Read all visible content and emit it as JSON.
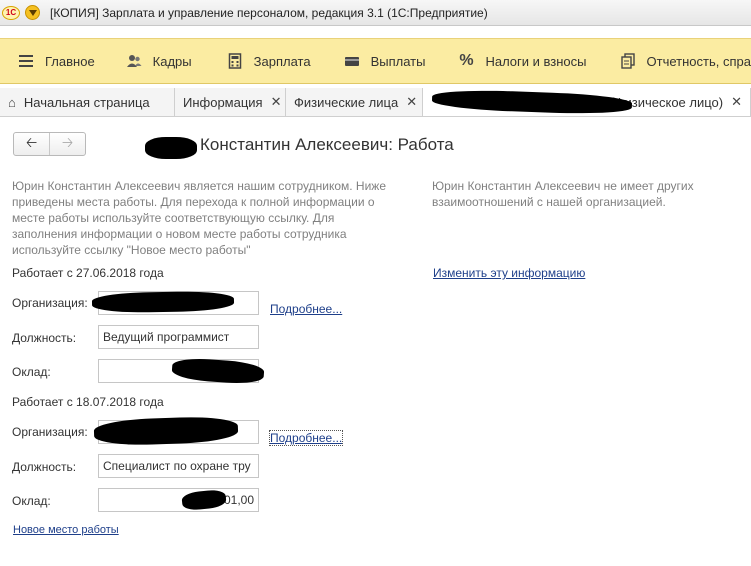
{
  "window": {
    "title": "[КОПИЯ] Зарплата и управление персоналом, редакция 3.1  (1С:Предприятие)"
  },
  "sections": [
    {
      "label": "Главное",
      "icon": "menu-lines-icon"
    },
    {
      "label": "Кадры",
      "icon": "people-icon"
    },
    {
      "label": "Зарплата",
      "icon": "calculator-icon"
    },
    {
      "label": "Выплаты",
      "icon": "wallet-icon"
    },
    {
      "label": "Налоги и взносы",
      "icon": "percent-icon"
    },
    {
      "label": "Отчетность, справ",
      "icon": "documents-icon"
    }
  ],
  "tabs": [
    {
      "label": "Начальная страница"
    },
    {
      "label": "Информация"
    },
    {
      "label": "Физические лица"
    },
    {
      "label": "(Физическое лицо)"
    }
  ],
  "form": {
    "title": "Константин Алексеевич: Работа",
    "intro": "Юрин Константин Алексеевич является нашим сотрудником. Ниже приведены места работы. Для перехода к полной информации о месте работы используйте соответствующую ссылку. Для заполнения информации о новом месте работы сотрудника используйте ссылку \"Новое место работы\"",
    "side_note": "Юрин Константин Алексеевич не имеет других взаимоотношений с нашей организацией.",
    "change_link": "Изменить эту информацию",
    "jobs": [
      {
        "since": "Работает с 27.06.2018 года",
        "org_label": "Организация:",
        "org_value": "",
        "more_link": "Подробнее...",
        "position_label": "Должность:",
        "position_value": "Ведущий программист",
        "salary_label": "Оклад:",
        "salary_value": ""
      },
      {
        "since": "Работает с 18.07.2018 года",
        "org_label": "Организация:",
        "org_value": "",
        "more_link": "Подробнее...",
        "position_label": "Должность:",
        "position_value": "Специалист по охране тру",
        "salary_label": "Оклад:",
        "salary_value": "01,00"
      }
    ],
    "new_job_link": "Новое место работы"
  }
}
